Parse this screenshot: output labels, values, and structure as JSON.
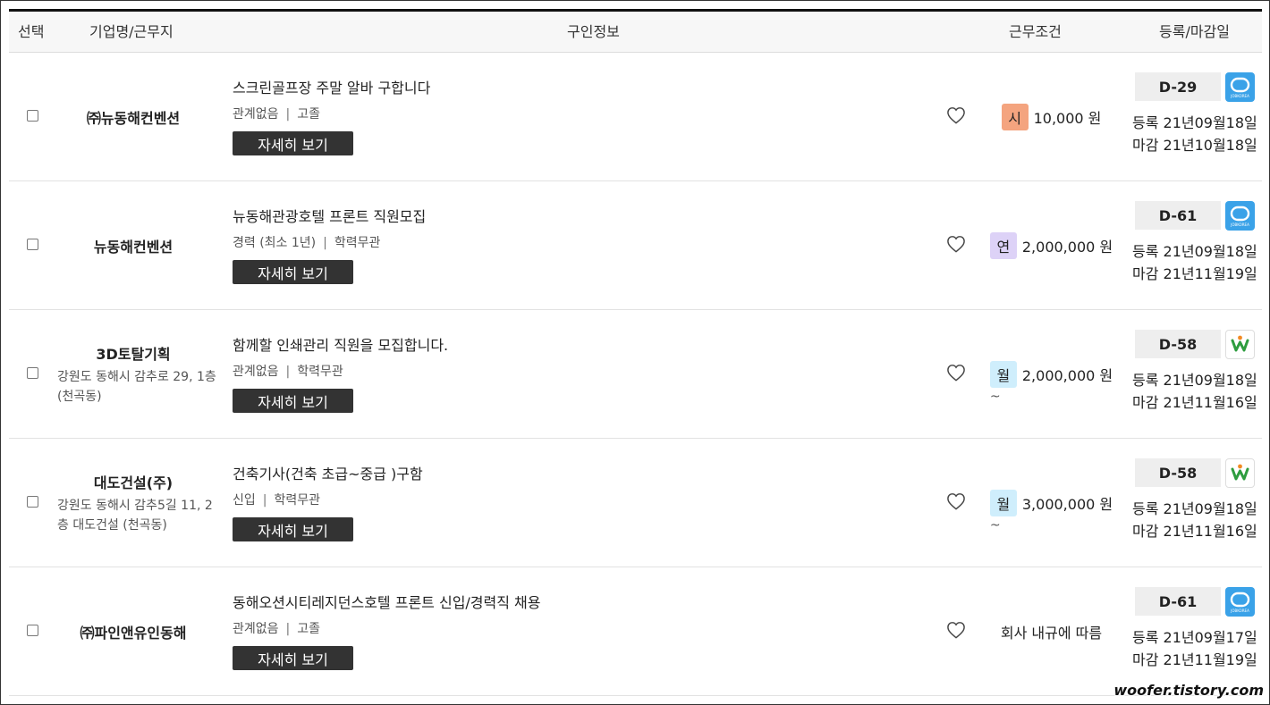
{
  "header": {
    "select": "선택",
    "company": "기업명/근무지",
    "info": "구인정보",
    "conditions": "근무조건",
    "dates": "등록/마감일"
  },
  "colors": {
    "hourly": "#f4a47f",
    "annual": "#ddd2f7",
    "monthly": "#cfeefc",
    "jobkorea": "#3aa2e8",
    "worknet_green": "#2e9d3f",
    "worknet_orange": "#f28b23"
  },
  "rows": [
    {
      "company": "㈜뉴동해컨벤션",
      "address": "",
      "title": "스크린골프장 주말 알바 구합니다",
      "experience": "관계없음",
      "education": "고졸",
      "detail_label": "자세히 보기",
      "pay_type": "시",
      "pay_amount": "10,000 원",
      "pay_tilde": "",
      "dday": "D-29",
      "source_icon": "jobkorea-logo",
      "source_text": "JOBKOREA",
      "registered": "등록 21년09월18일",
      "deadline": "마감 21년10월18일"
    },
    {
      "company": "뉴동해컨벤션",
      "address": "",
      "title": "뉴동해관광호텔 프론트 직원모집",
      "experience": "경력 (최소 1년)",
      "education": "학력무관",
      "detail_label": "자세히 보기",
      "pay_type": "연",
      "pay_amount": "2,000,000 원",
      "pay_tilde": "",
      "dday": "D-61",
      "source_icon": "jobkorea-logo",
      "source_text": "JOBKOREA",
      "registered": "등록 21년09월18일",
      "deadline": "마감 21년11월19일"
    },
    {
      "company": "3D토탈기획",
      "address": "강원도 동해시 감추로 29, 1층 (천곡동)",
      "title": "함께할 인쇄관리 직원을 모집합니다.",
      "experience": "관계없음",
      "education": "학력무관",
      "detail_label": "자세히 보기",
      "pay_type": "월",
      "pay_amount": "2,000,000 원",
      "pay_tilde": "~",
      "dday": "D-58",
      "source_icon": "worknet-logo",
      "source_text": "",
      "registered": "등록 21년09월18일",
      "deadline": "마감 21년11월16일"
    },
    {
      "company": "대도건설(주)",
      "address": "강원도 동해시 감추5길 11, 2층 대도건설 (천곡동)",
      "title": "건축기사(건축 초급~중급 )구함",
      "experience": "신입",
      "education": "학력무관",
      "detail_label": "자세히 보기",
      "pay_type": "월",
      "pay_amount": "3,000,000 원",
      "pay_tilde": "~",
      "dday": "D-58",
      "source_icon": "worknet-logo",
      "source_text": "",
      "registered": "등록 21년09월18일",
      "deadline": "마감 21년11월16일"
    },
    {
      "company": "㈜파인앤유인동해",
      "address": "",
      "title": "동해오션시티레지던스호텔 프론트 신입/경력직 채용",
      "experience": "관계없음",
      "education": "고졸",
      "detail_label": "자세히 보기",
      "pay_type": "",
      "pay_amount": "회사 내규에 따름",
      "pay_tilde": "",
      "dday": "D-61",
      "source_icon": "jobkorea-logo",
      "source_text": "JOBKOREA",
      "registered": "등록 21년09월17일",
      "deadline": "마감 21년11월19일"
    }
  ],
  "watermark": "woofer.tistory.com"
}
